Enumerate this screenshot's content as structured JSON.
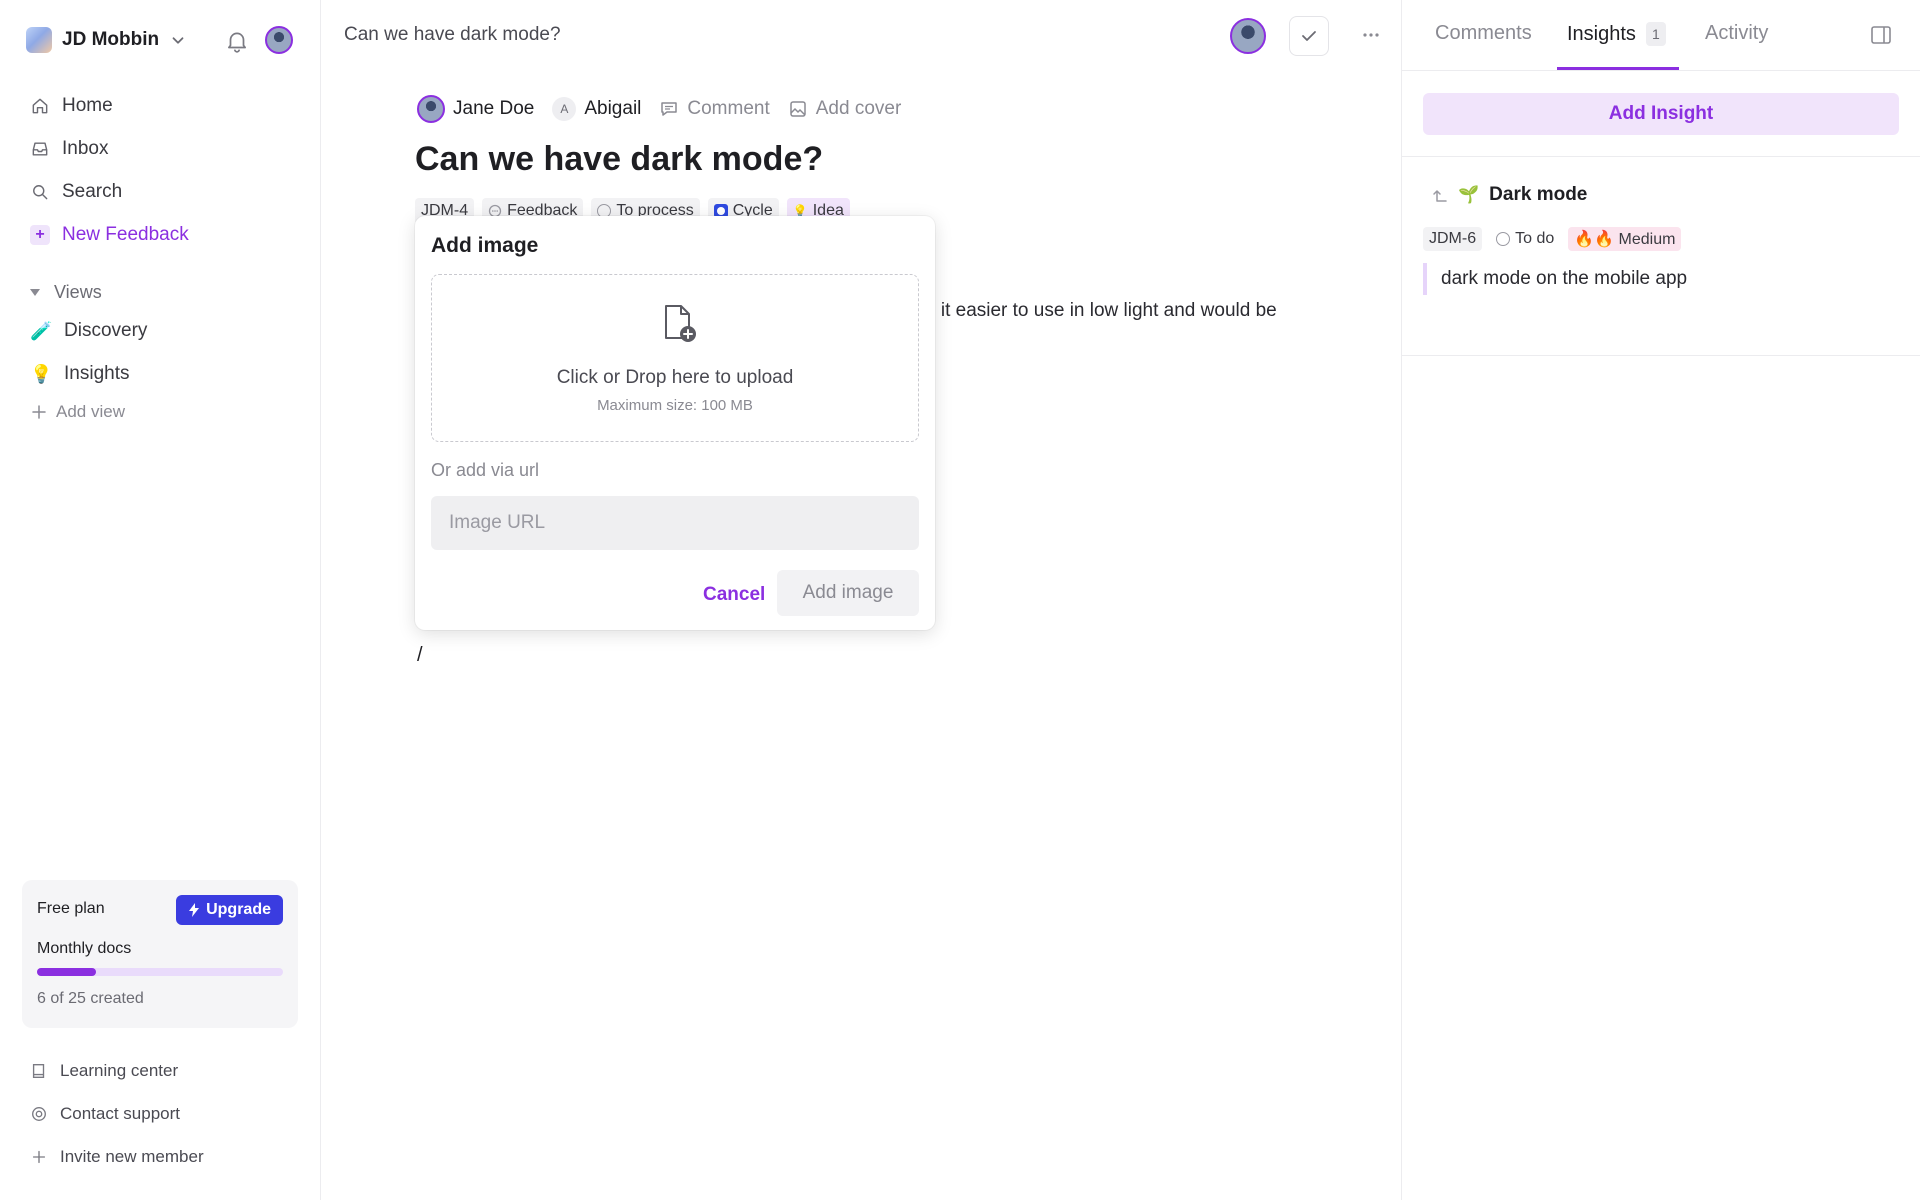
{
  "sidebar": {
    "workspace_name": "JD Mobbin",
    "nav": [
      {
        "label": "Home"
      },
      {
        "label": "Inbox"
      },
      {
        "label": "Search"
      },
      {
        "label": "New Feedback"
      }
    ],
    "views_label": "Views",
    "views": [
      {
        "label": "Discovery",
        "emoji": "🧪"
      },
      {
        "label": "Insights",
        "emoji": "💡"
      }
    ],
    "add_view": "Add view",
    "plan": {
      "title": "Free plan",
      "upgrade": "Upgrade",
      "docs_label": "Monthly docs",
      "used": 6,
      "total": 25,
      "created_text": "6 of 25 created",
      "progress_fraction": 0.24
    },
    "footer": [
      {
        "label": "Learning center"
      },
      {
        "label": "Contact support"
      },
      {
        "label": "Invite new member"
      }
    ]
  },
  "topbar": {
    "breadcrumb": "Can we have dark mode?"
  },
  "doc": {
    "meta": {
      "author": "Jane Doe",
      "assignee_initial": "A",
      "assignee": "Abigail",
      "comment": "Comment",
      "add_cover": "Add cover"
    },
    "title": "Can we have dark mode?",
    "chips": [
      "JDM-4",
      "Feedback",
      "To process",
      "Cycle",
      "Idea"
    ],
    "body_fragment": "e it easier to use in low light and would be",
    "slash": "/"
  },
  "modal": {
    "title": "Add image",
    "drop_main": "Click or Drop here to upload",
    "drop_sub": "Maximum size: 100 MB",
    "via_url": "Or add via url",
    "url_placeholder": "Image URL",
    "cancel": "Cancel",
    "add": "Add image"
  },
  "panel": {
    "tabs": [
      {
        "label": "Comments"
      },
      {
        "label": "Insights",
        "count": "1"
      },
      {
        "label": "Activity"
      }
    ],
    "add_insight": "Add Insight",
    "insight": {
      "title": "Dark mode",
      "emoji": "🌱",
      "id": "JDM-6",
      "status": "To do",
      "priority": "🔥🔥 Medium",
      "quote": "dark mode on the mobile app"
    }
  },
  "colors": {
    "accent": "#8b2fe0",
    "upgrade": "#3a3ce0"
  }
}
